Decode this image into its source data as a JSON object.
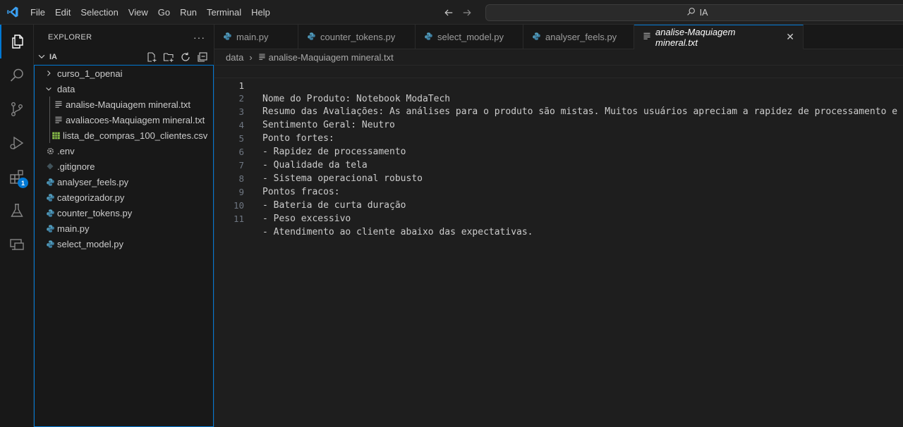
{
  "menu": [
    "File",
    "Edit",
    "Selection",
    "View",
    "Go",
    "Run",
    "Terminal",
    "Help"
  ],
  "search": {
    "text": "IA"
  },
  "explorer": {
    "title": "EXPLORER",
    "more": "···",
    "folder": "IA",
    "items": [
      {
        "label": "curso_1_openai",
        "type": "folder-collapsed",
        "icon": "chevron-right-icon"
      },
      {
        "label": "data",
        "type": "folder-open",
        "icon": "chevron-down-icon"
      },
      {
        "label": "analise-Maquiagem mineral.txt",
        "type": "txt",
        "icon": "text-file-icon"
      },
      {
        "label": "avaliacoes-Maquiagem mineral.txt",
        "type": "txt",
        "icon": "text-file-icon"
      },
      {
        "label": "lista_de_compras_100_clientes.csv",
        "type": "csv",
        "icon": "csv-file-icon"
      },
      {
        "label": ".env",
        "type": "env",
        "icon": "gear-file-icon"
      },
      {
        "label": ".gitignore",
        "type": "git",
        "icon": "git-file-icon"
      },
      {
        "label": "analyser_feels.py",
        "type": "py",
        "icon": "python-file-icon"
      },
      {
        "label": "categorizador.py",
        "type": "py",
        "icon": "python-file-icon"
      },
      {
        "label": "counter_tokens.py",
        "type": "py",
        "icon": "python-file-icon"
      },
      {
        "label": "main.py",
        "type": "py",
        "icon": "python-file-icon"
      },
      {
        "label": "select_model.py",
        "type": "py",
        "icon": "python-file-icon"
      }
    ]
  },
  "tabs": [
    {
      "label": "main.py"
    },
    {
      "label": "counter_tokens.py"
    },
    {
      "label": "select_model.py"
    },
    {
      "label": "analyser_feels.py"
    },
    {
      "label": "analise-Maquiagem mineral.txt",
      "close": "✕"
    }
  ],
  "breadcrumb": {
    "folder": "data",
    "sep": "›",
    "file": "analise-Maquiagem mineral.txt"
  },
  "activity": {
    "extensions_badge": "1"
  },
  "editor": {
    "lines": [
      "Nome do Produto: Notebook ModaTech",
      "Resumo das Avaliações: As análises para o produto são mistas. Muitos usuários apreciam a rapidez de processamento e a",
      "Sentimento Geral: Neutro",
      "Ponto fortes:",
      "- Rapidez de processamento",
      "- Qualidade da tela",
      "- Sistema operacional robusto",
      "Pontos fracos:",
      "- Bateria de curta duração",
      "- Peso excessivo",
      "- Atendimento ao cliente abaixo das expectativas."
    ],
    "line_numbers": [
      "1",
      "2",
      "3",
      "4",
      "5",
      "6",
      "7",
      "8",
      "9",
      "10",
      "11"
    ]
  },
  "colors": {
    "accent": "#0078d4",
    "python": "#519aba",
    "csv": "#8bc34a"
  }
}
